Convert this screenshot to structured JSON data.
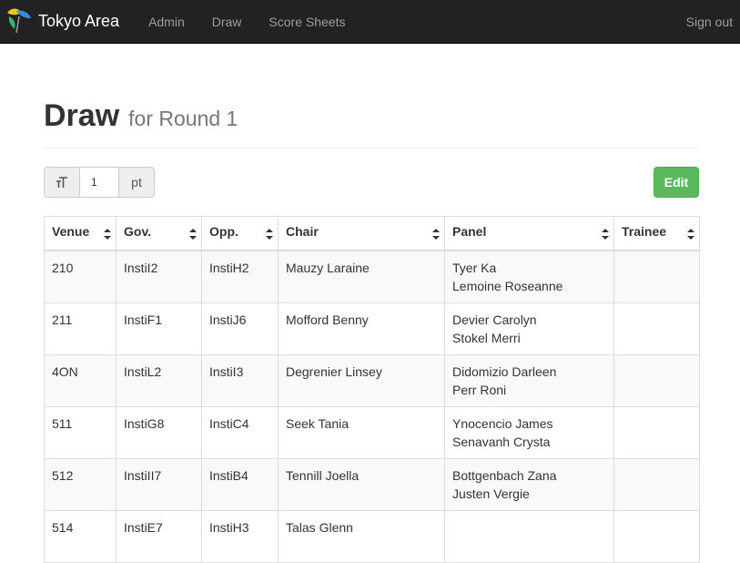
{
  "navbar": {
    "brand": "Tokyo Area",
    "links": [
      "Admin",
      "Draw",
      "Score Sheets"
    ],
    "sign_out": "Sign out"
  },
  "page": {
    "title": "Draw",
    "subtitle": "for Round 1"
  },
  "toolbar": {
    "font_icon_text": "T",
    "font_size_value": "1",
    "font_unit": "pt",
    "edit_label": "Edit"
  },
  "table": {
    "headers": [
      "Venue",
      "Gov.",
      "Opp.",
      "Chair",
      "Panel",
      "Trainee"
    ],
    "rows": [
      {
        "venue": "210",
        "gov": "InstiI2",
        "opp": "InstiH2",
        "chair": "Mauzy Laraine",
        "panel": [
          "Tyer Ka",
          "Lemoine Roseanne"
        ],
        "trainee": ""
      },
      {
        "venue": "211",
        "gov": "InstiF1",
        "opp": "InstiJ6",
        "chair": "Mofford Benny",
        "panel": [
          "Devier Carolyn",
          "Stokel Merri"
        ],
        "trainee": ""
      },
      {
        "venue": "4ON",
        "gov": "InstiL2",
        "opp": "InstiI3",
        "chair": "Degrenier Linsey",
        "panel": [
          "Didomizio Darleen",
          "Perr Roni"
        ],
        "trainee": ""
      },
      {
        "venue": "511",
        "gov": "InstiG8",
        "opp": "InstiC4",
        "chair": "Seek Tania",
        "panel": [
          "Ynocencio James",
          "Senavanh Crysta"
        ],
        "trainee": ""
      },
      {
        "venue": "512",
        "gov": "InstiII7",
        "opp": "InstiB4",
        "chair": "Tennill Joella",
        "panel": [
          "Bottgenbach Zana",
          "Justen Vergie"
        ],
        "trainee": ""
      },
      {
        "venue": "514",
        "gov": "InstiE7",
        "opp": "InstiH3",
        "chair": "Talas Glenn",
        "panel": [
          "",
          ""
        ],
        "trainee": ""
      }
    ]
  },
  "colors": {
    "navbar_bg": "#222222",
    "edit_button": "#5cb85c"
  }
}
